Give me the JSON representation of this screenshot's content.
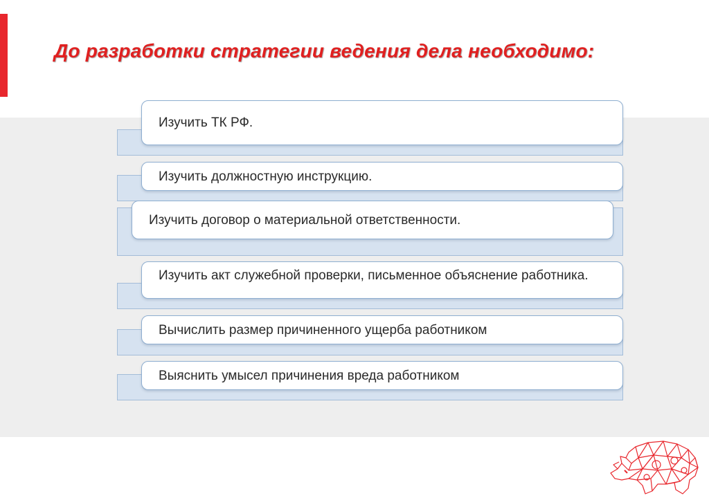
{
  "title": "До разработки стратегии ведения дела необходимо:",
  "items": [
    {
      "text": "Изучить ТК РФ."
    },
    {
      "text": "Изучить должностную инструкцию."
    },
    {
      "text": "Изучить договор о материальной ответственности."
    },
    {
      "text": "Изучить акт служебной проверки, письменное объяснение работника."
    },
    {
      "text": "Вычислить размер причиненного ущерба работником"
    },
    {
      "text": "Выяснить умысел причинения вреда работником"
    }
  ],
  "colors": {
    "accent": "#e8272d",
    "title": "#e02020",
    "card_border": "#8eaed0",
    "backbar_fill": "#d6e2f0",
    "band": "#eeeeee"
  },
  "logo": {
    "icon": "rhino-logo-icon"
  }
}
